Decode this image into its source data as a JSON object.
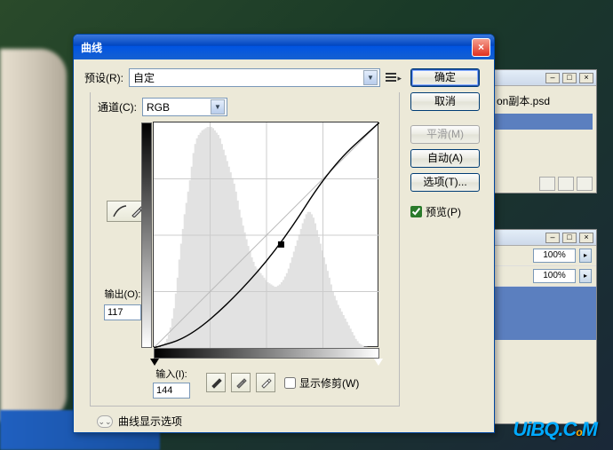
{
  "dialog": {
    "title": "曲线",
    "preset_label": "预设(R):",
    "preset_value": "自定",
    "channel_label": "通道(C):",
    "channel_value": "RGB",
    "output_label": "输出(O):",
    "output_value": "117",
    "input_label": "输入(I):",
    "input_value": "144",
    "show_clipping_label": "显示修剪(W)",
    "show_clipping_checked": false,
    "expand_label": "曲线显示选项",
    "preview_label": "预览(P)",
    "preview_checked": true
  },
  "buttons": {
    "ok": "确定",
    "cancel": "取消",
    "smooth": "平滑(M)",
    "auto": "自动(A)",
    "options": "选项(T)..."
  },
  "bg_panel": {
    "filename": "on副本.psd"
  },
  "bg_panel2": {
    "opacity1": "100%",
    "opacity2": "100%"
  },
  "icons": {
    "curve_tool": "curve",
    "pencil_tool": "pencil"
  },
  "chart_data": {
    "type": "line",
    "title": "",
    "xlabel": "输入",
    "ylabel": "输出",
    "xlim": [
      0,
      255
    ],
    "ylim": [
      0,
      255
    ],
    "series": [
      {
        "name": "baseline",
        "x": [
          0,
          255
        ],
        "y": [
          0,
          255
        ]
      },
      {
        "name": "curve",
        "x": [
          0,
          40,
          90,
          144,
          200,
          255
        ],
        "y": [
          0,
          12,
          55,
          117,
          205,
          255
        ]
      }
    ],
    "point": {
      "x": 144,
      "y": 117
    },
    "histogram": [
      0,
      0,
      0,
      1,
      2,
      3,
      5,
      8,
      12,
      18,
      26,
      35,
      48,
      62,
      78,
      92,
      105,
      118,
      128,
      138,
      148,
      160,
      172,
      180,
      185,
      188,
      190,
      192,
      193,
      194,
      195,
      195,
      195,
      194,
      192,
      190,
      188,
      185,
      180,
      175,
      170,
      165,
      160,
      155,
      150,
      145,
      138,
      130,
      122,
      115,
      108,
      102,
      96,
      90,
      85,
      80,
      76,
      72,
      70,
      68,
      66,
      64,
      62,
      60,
      58,
      57,
      56,
      55,
      54,
      54,
      55,
      56,
      58,
      60,
      63,
      66,
      70,
      75,
      80,
      85,
      90,
      95,
      100,
      105,
      110,
      114,
      118,
      120,
      120,
      118,
      115,
      110,
      104,
      98,
      92,
      86,
      80,
      74,
      68,
      62,
      56,
      50,
      46,
      42,
      38,
      35,
      32,
      29,
      26,
      23,
      20,
      17,
      14,
      11,
      8,
      6,
      4,
      3,
      2,
      1,
      1,
      0,
      0,
      0,
      0,
      0,
      0,
      0
    ]
  },
  "watermark": "UiBQ.CoM"
}
